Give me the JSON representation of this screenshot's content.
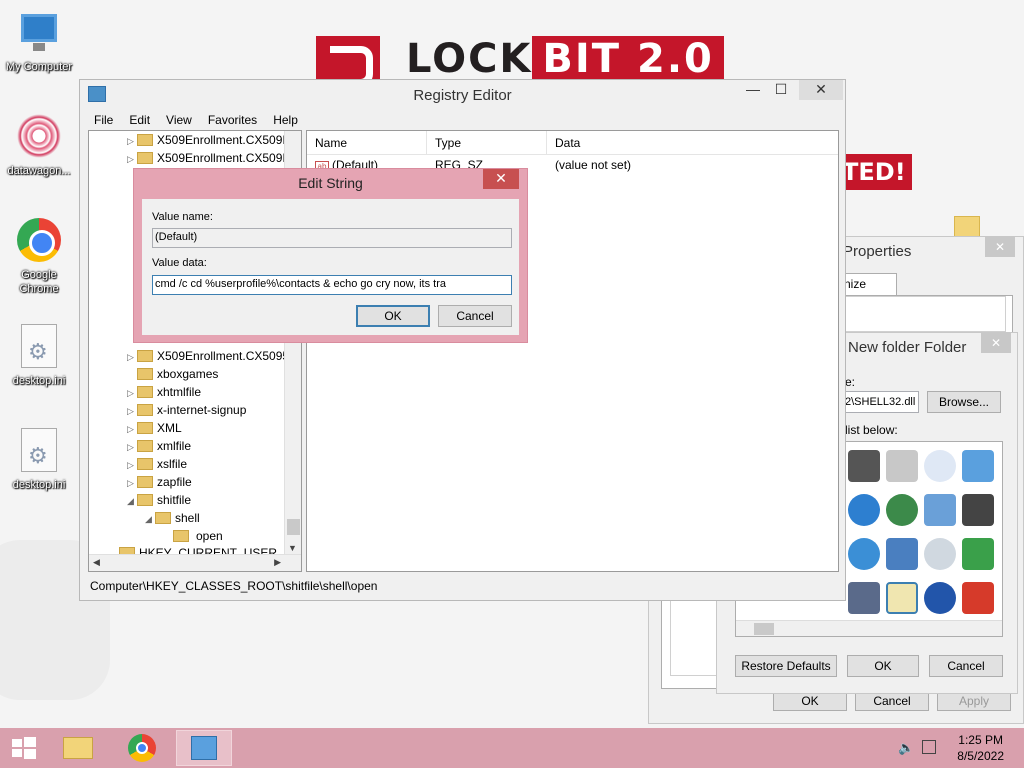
{
  "desktop": {
    "wallpaper": {
      "logo_text_1": "LOCK",
      "logo_text_2": "BIT 2.0",
      "banner_text": "TED!"
    },
    "icons": [
      {
        "label": "My Computer",
        "icon": "computer-icon"
      },
      {
        "label": "datawagon...",
        "icon": "app-icon"
      },
      {
        "label": "Google Chrome",
        "icon": "chrome-icon"
      },
      {
        "label": "desktop.ini",
        "icon": "settings-file-icon"
      },
      {
        "label": "desktop.ini",
        "icon": "settings-file-icon"
      }
    ]
  },
  "regedit": {
    "title": "Registry Editor",
    "menu": [
      "File",
      "Edit",
      "View",
      "Favorites",
      "Help"
    ],
    "tree": [
      {
        "label": "X509Enrollment.CX509I",
        "level": 0,
        "expander": "▷"
      },
      {
        "label": "X509Enrollment.CX509I",
        "level": 0,
        "expander": "▷"
      },
      {
        "label": "X509Enrollment.CX5095",
        "level": 0,
        "expander": "▷"
      },
      {
        "label": "xboxgames",
        "level": 0,
        "expander": ""
      },
      {
        "label": "xhtmlfile",
        "level": 0,
        "expander": "▷"
      },
      {
        "label": "x-internet-signup",
        "level": 0,
        "expander": "▷"
      },
      {
        "label": "XML",
        "level": 0,
        "expander": "▷"
      },
      {
        "label": "xmlfile",
        "level": 0,
        "expander": "▷"
      },
      {
        "label": "xslfile",
        "level": 0,
        "expander": "▷"
      },
      {
        "label": "zapfile",
        "level": 0,
        "expander": "▷"
      },
      {
        "label": "shitfile",
        "level": 0,
        "expander": "◢"
      },
      {
        "label": "shell",
        "level": 1,
        "expander": "◢"
      },
      {
        "label": "open",
        "level": 2,
        "expander": ""
      },
      {
        "label": "HKEY_CURRENT_USER",
        "level": -1,
        "expander": ""
      }
    ],
    "columns": [
      "Name",
      "Type",
      "Data"
    ],
    "values": [
      {
        "name": "(Default)",
        "type": "REG_SZ",
        "data": "(value not set)"
      }
    ],
    "status_path": "Computer\\HKEY_CLASSES_ROOT\\shitfile\\shell\\open"
  },
  "edit_string": {
    "title": "Edit String",
    "value_name_label": "Value name:",
    "value_name": "(Default)",
    "value_data_label": "Value data:",
    "value_data": "cmd /c cd %userprofile%\\contacts & echo go cry now, its tra",
    "ok_label": "OK",
    "cancel_label": "Cancel"
  },
  "properties": {
    "title": "Properties",
    "tab_partial": "nize",
    "ok_label": "OK",
    "cancel_label": "Cancel",
    "apply_label": "Apply"
  },
  "change_icon": {
    "title": "New folder Folder",
    "field_label_partial": "e:",
    "file_value": "2\\SHELL32.dll",
    "browse_label": "Browse...",
    "list_label": "list below:",
    "restore_label": "Restore Defaults",
    "ok_label": "OK",
    "cancel_label": "Cancel"
  },
  "taskbar": {
    "time": "1:25 PM",
    "date": "8/5/2022"
  },
  "colors": {
    "accent": "#d9a0ad",
    "dialog_frame": "#e5a4b3",
    "lockbit_red": "#c4162a",
    "close_red": "#c75050"
  }
}
